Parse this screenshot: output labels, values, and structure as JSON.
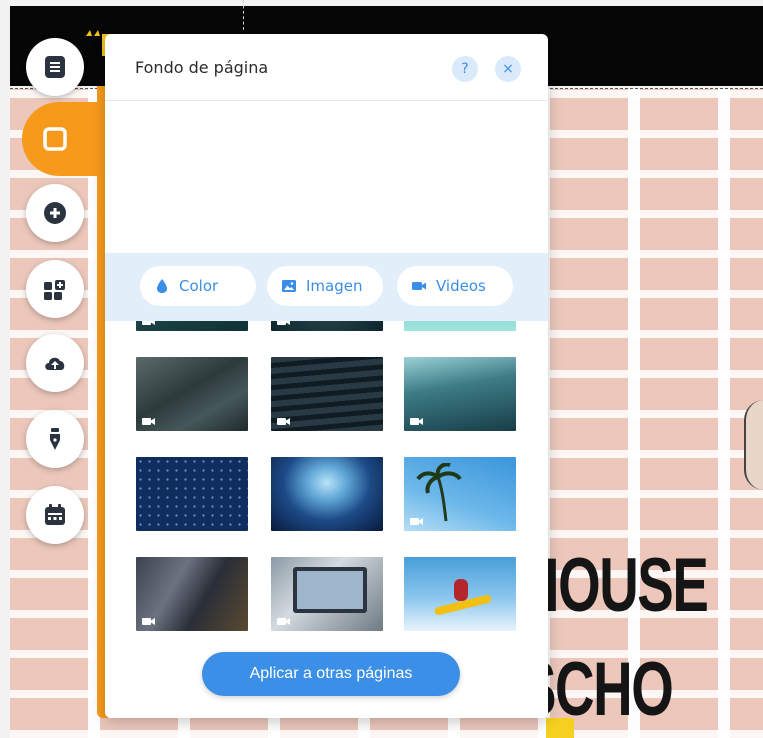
{
  "panel": {
    "title": "Fondo de página",
    "help_label": "?",
    "close_label": "×",
    "apply_label": "Aplicar a otras páginas"
  },
  "tabs": [
    {
      "label": "Color",
      "icon": "droplet-icon"
    },
    {
      "label": "Imagen",
      "icon": "image-icon"
    },
    {
      "label": "Videos",
      "icon": "video-camera-icon"
    }
  ],
  "sidebar": {
    "items": [
      {
        "icon": "pages-icon"
      },
      {
        "icon": "background-icon",
        "active": true
      },
      {
        "icon": "add-icon"
      },
      {
        "icon": "apps-icon"
      },
      {
        "icon": "upload-cloud-icon"
      },
      {
        "icon": "pen-icon"
      },
      {
        "icon": "calendar-icon"
      }
    ]
  },
  "canvas": {
    "hero_line1": "HOUSE",
    "hero_line2": "SCHO"
  },
  "colors": {
    "accent_orange": "#f79a1c",
    "accent_blue": "#3b8fe7",
    "tab_bar_blue": "#e3eefb"
  }
}
